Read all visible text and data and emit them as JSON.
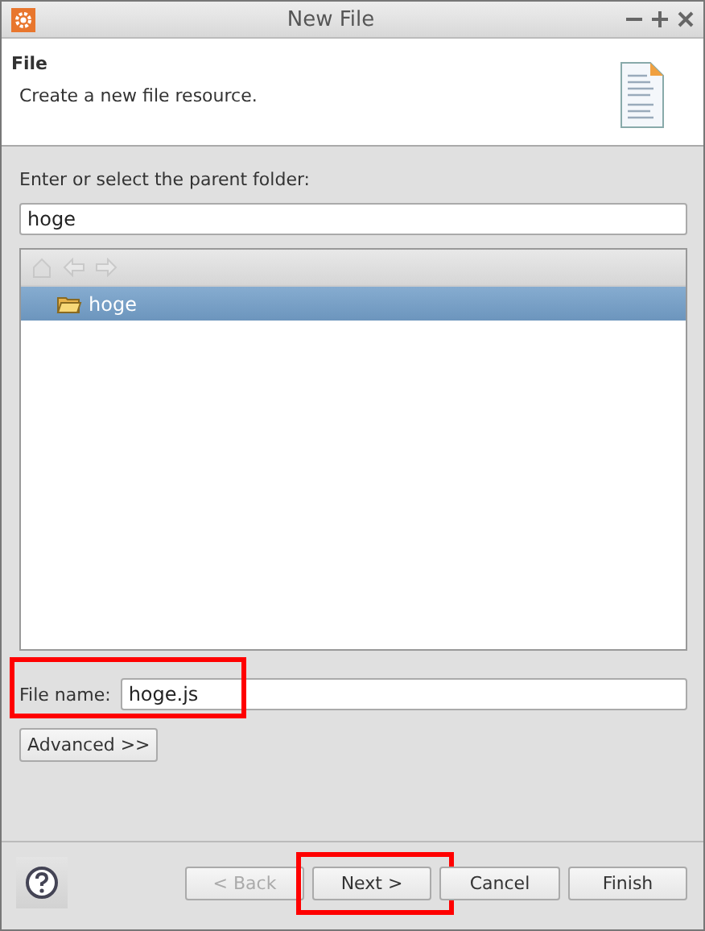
{
  "window": {
    "title": "New File"
  },
  "header": {
    "title": "File",
    "description": "Create a new file resource."
  },
  "parent_folder": {
    "label": "Enter or select the parent folder:",
    "value": "hoge"
  },
  "tree": {
    "nav_buttons": [
      {
        "kind": "home",
        "disabled": true
      },
      {
        "kind": "back",
        "disabled": true
      },
      {
        "kind": "forward",
        "disabled": true
      }
    ],
    "items": [
      {
        "label": "hoge",
        "selected": true
      }
    ]
  },
  "file_name": {
    "label": "File name:",
    "value": "hoge.js",
    "highlighted": true
  },
  "advanced_button": "Advanced >>",
  "buttons": [
    {
      "label": "< Back",
      "disabled": true,
      "highlighted": false
    },
    {
      "label": "Next >",
      "disabled": false,
      "highlighted": true
    },
    {
      "label": "Cancel",
      "disabled": false,
      "highlighted": false
    },
    {
      "label": "Finish",
      "disabled": false,
      "highlighted": false
    }
  ]
}
